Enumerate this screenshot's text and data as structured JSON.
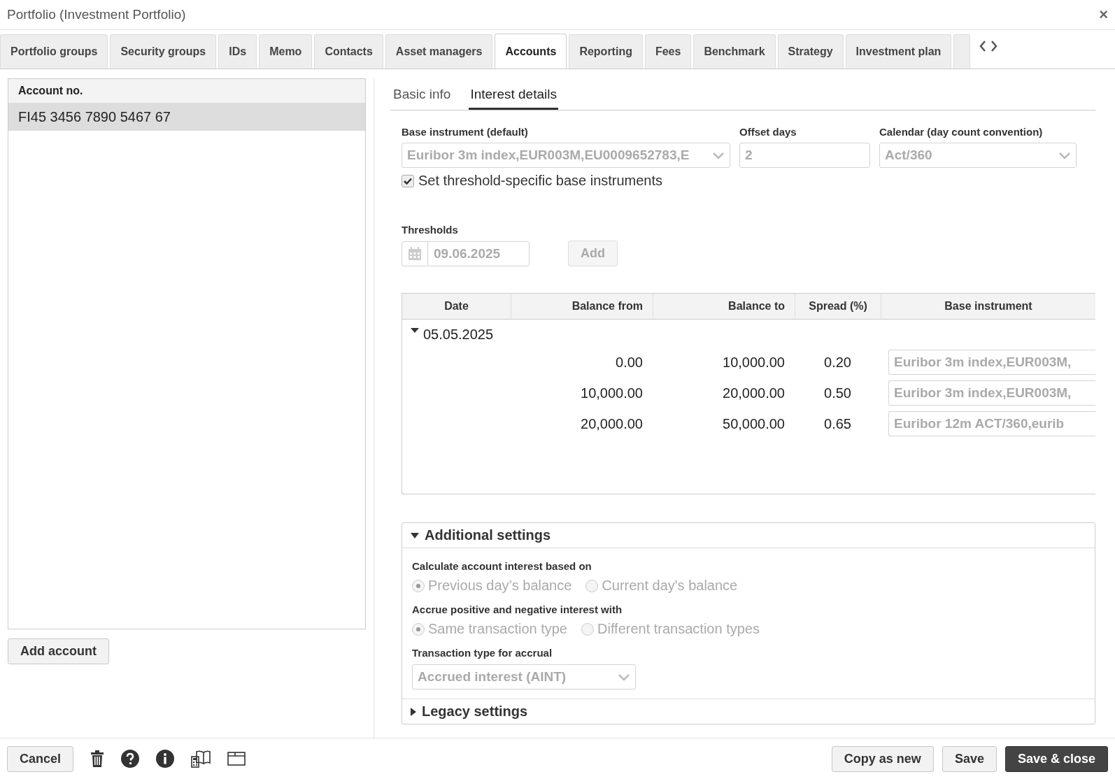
{
  "window": {
    "title": "Portfolio (Investment Portfolio)",
    "close": "×"
  },
  "tabs": [
    {
      "label": "Portfolio groups",
      "selected": false
    },
    {
      "label": "Security groups",
      "selected": false
    },
    {
      "label": "IDs",
      "selected": false
    },
    {
      "label": "Memo",
      "selected": false
    },
    {
      "label": "Contacts",
      "selected": false
    },
    {
      "label": "Asset managers",
      "selected": false
    },
    {
      "label": "Accounts",
      "selected": true
    },
    {
      "label": "Reporting",
      "selected": false
    },
    {
      "label": "Fees",
      "selected": false
    },
    {
      "label": "Benchmark",
      "selected": false
    },
    {
      "label": "Strategy",
      "selected": false
    },
    {
      "label": "Investment plan",
      "selected": false
    }
  ],
  "accounts": {
    "column": "Account no.",
    "rows": [
      {
        "number": "FI45 3456 7890 5467 67",
        "selected": true
      }
    ],
    "add_button": "Add account"
  },
  "subtabs": [
    {
      "label": "Basic info",
      "selected": false
    },
    {
      "label": "Interest details",
      "selected": true
    }
  ],
  "base_instrument": {
    "label": "Base instrument (default)",
    "value": "Euribor 3m index,EUR003M,EU0009652783,E"
  },
  "offset_days": {
    "label": "Offset days",
    "value": "2"
  },
  "calendar": {
    "label": "Calendar (day count convention)",
    "value": "Act/360"
  },
  "threshold_specific": {
    "label": "Set threshold-specific base instruments",
    "checked": true
  },
  "thresholds": {
    "label": "Thresholds",
    "date": "09.06.2025",
    "add_button": "Add"
  },
  "table": {
    "columns": [
      "Date",
      "Balance from",
      "Balance to",
      "Spread (%)",
      "Base instrument"
    ],
    "groups": [
      {
        "date": "05.05.2025",
        "expanded": true,
        "rows": [
          {
            "balance_from": "0.00",
            "balance_to": "10,000.00",
            "spread": "0.20",
            "base_instrument": "Euribor 3m index,EUR003M,"
          },
          {
            "balance_from": "10,000.00",
            "balance_to": "20,000.00",
            "spread": "0.50",
            "base_instrument": "Euribor 3m index,EUR003M,"
          },
          {
            "balance_from": "20,000.00",
            "balance_to": "50,000.00",
            "spread": "0.65",
            "base_instrument": "Euribor 12m ACT/360,eurib"
          }
        ]
      }
    ]
  },
  "additional_settings": {
    "title": "Additional settings",
    "expanded": true,
    "sections": [
      {
        "kind": "radio",
        "label": "Calculate account interest based on",
        "options": [
          {
            "label": "Previous day’s balance",
            "selected": true
          },
          {
            "label": "Current day's balance",
            "selected": false
          }
        ]
      },
      {
        "kind": "radio",
        "label": "Accrue positive and negative interest with",
        "options": [
          {
            "label": "Same transaction type",
            "selected": true
          },
          {
            "label": "Different transaction types",
            "selected": false
          }
        ]
      },
      {
        "kind": "select",
        "label": "Transaction type for accrual",
        "value": "Accrued interest (AINT)"
      }
    ]
  },
  "legacy_settings": {
    "title": "Legacy settings",
    "expanded": false
  },
  "footer": {
    "cancel": "Cancel",
    "buttons": [
      {
        "label": "Copy as new",
        "kind": "default"
      },
      {
        "label": "Save",
        "kind": "default"
      },
      {
        "label": "Save & close",
        "kind": "primary"
      }
    ]
  }
}
